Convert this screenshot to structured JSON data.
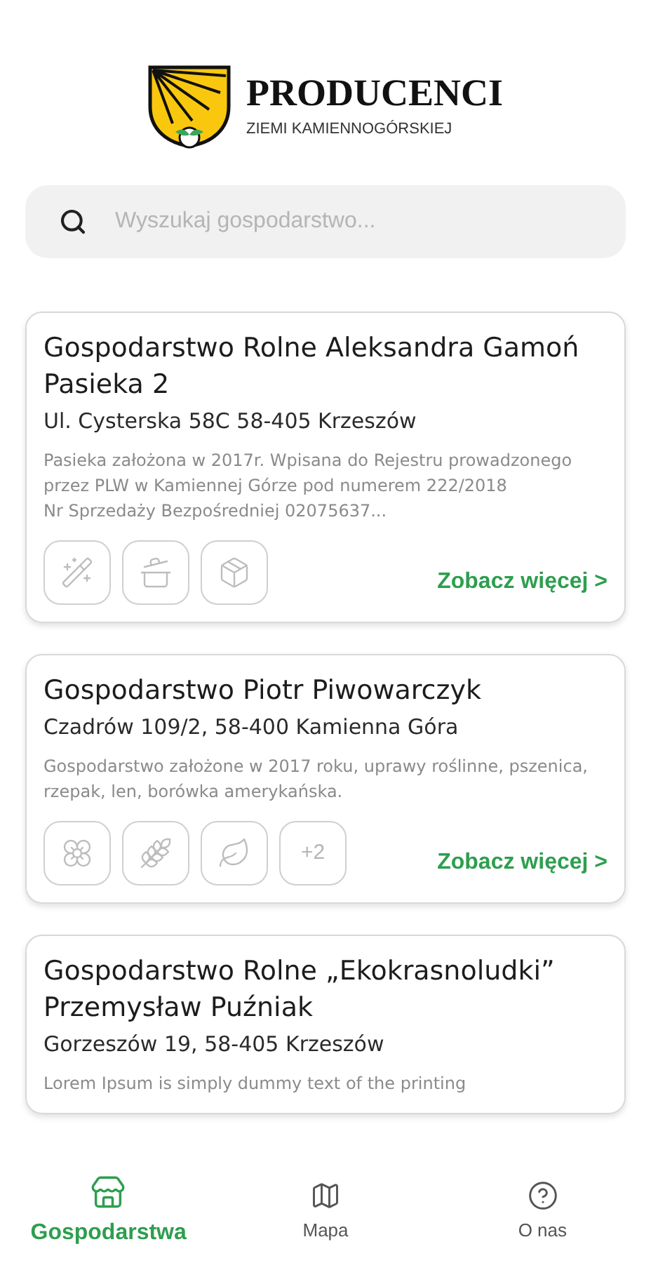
{
  "logo": {
    "title": "PRODUCENCI",
    "subtitle": "ZIEMI KAMIENNOGÓRSKIEJ"
  },
  "search": {
    "placeholder": "Wyszukaj gospodarstwo..."
  },
  "farms": [
    {
      "name": "Gospodarstwo Rolne Aleksandra Gamoń Pasieka 2",
      "address": "Ul. Cysterska 58C 58-405 Krzeszów",
      "description": "Pasieka założona w 2017r. Wpisana do Rejestru prowadzonego przez PLW w Kamiennej Górze pod numerem 222/2018\nNr Sprzedaży Bezpośredniej 02075637...",
      "products": [
        {
          "kind": "wand"
        },
        {
          "kind": "pot"
        },
        {
          "kind": "package"
        }
      ],
      "link": "Zobacz więcej >"
    },
    {
      "name": "Gospodarstwo Piotr Piwowarczyk",
      "address": "Czadrów 109/2, 58-400 Kamienna Góra",
      "description": "Gospodarstwo założone w 2017 roku, uprawy roślinne, pszenica, rzepak, len, borówka amerykańska.",
      "products": [
        {
          "kind": "flower"
        },
        {
          "kind": "wheat"
        },
        {
          "kind": "leaf"
        }
      ],
      "more": "+2",
      "link": "Zobacz więcej >"
    },
    {
      "name": "Gospodarstwo Rolne „Ekokrasnoludki” Przemysław Puźniak",
      "address": "Gorzeszów 19, 58-405 Krzeszów",
      "description": "Lorem Ipsum is simply dummy text of the printing"
    }
  ],
  "nav": [
    {
      "kind": "store",
      "label": "Gospodarstwa",
      "selected": true
    },
    {
      "kind": "map",
      "label": "Mapa",
      "selected": false
    },
    {
      "kind": "help",
      "label": "O nas",
      "selected": false
    }
  ]
}
